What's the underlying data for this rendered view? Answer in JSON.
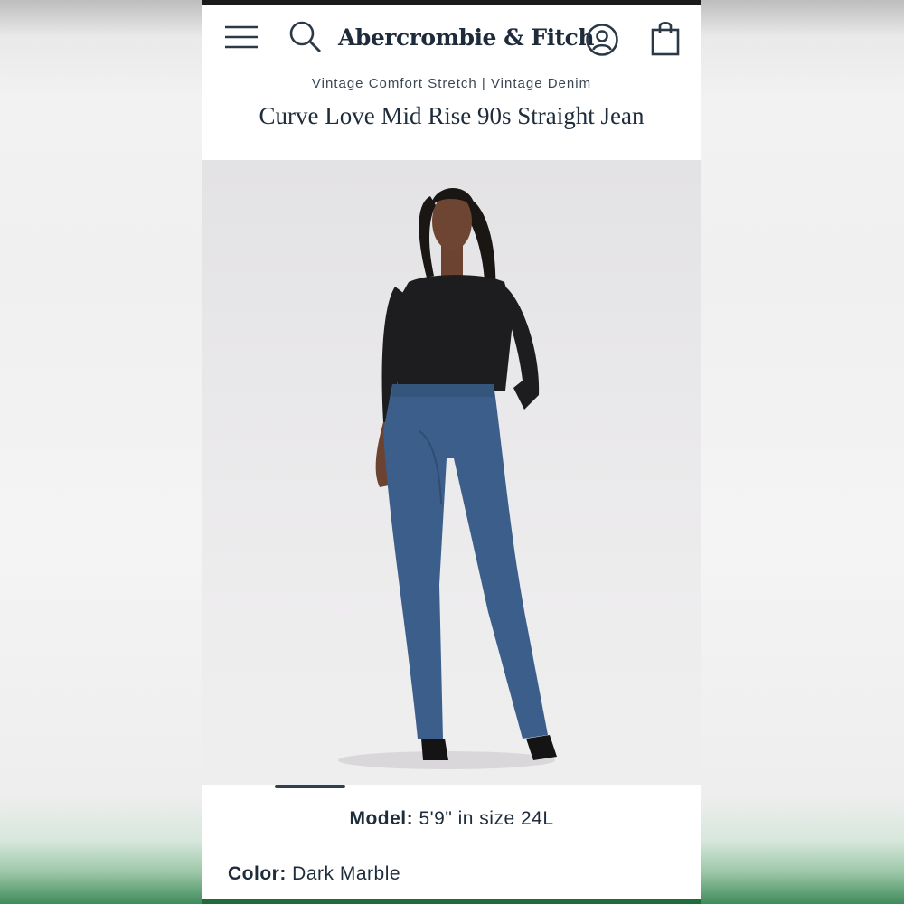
{
  "header": {
    "brand": "Abercrombie & Fitch",
    "icons": {
      "menu": "hamburger-menu-icon",
      "search": "search-icon",
      "account": "user-account-icon",
      "bag": "shopping-bag-icon"
    }
  },
  "product": {
    "breadcrumb": "Vintage Comfort Stretch | Vintage Denim",
    "title": "Curve Love Mid Rise 90s Straight Jean",
    "model_label": "Model:",
    "model_value": "5'9\" in size 24L",
    "color_label": "Color:",
    "color_value": "Dark Marble"
  },
  "carousel": {
    "active_index": 0
  },
  "colors": {
    "brand_navy": "#1d2b3a",
    "footer_green": "#1f6b3c"
  }
}
